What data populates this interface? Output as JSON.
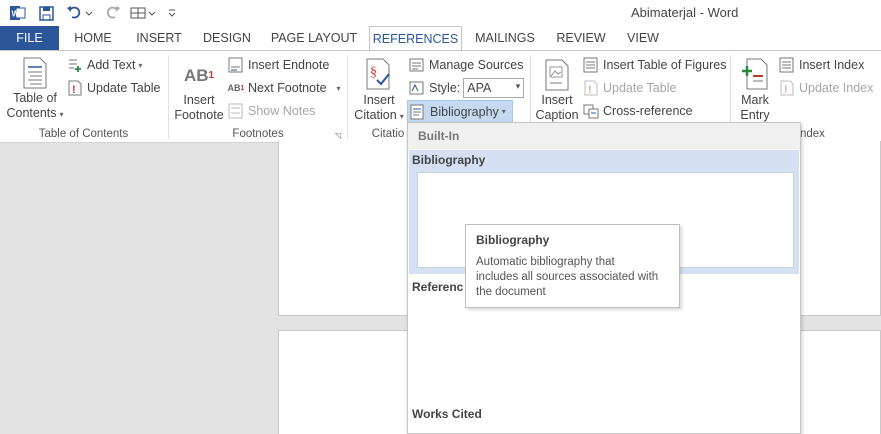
{
  "window": {
    "title": "Abimaterjal - Word"
  },
  "qat": {
    "undo_icon": "undo-icon",
    "redo_icon": "redo-icon"
  },
  "tabs": [
    {
      "label": "FILE"
    },
    {
      "label": "HOME"
    },
    {
      "label": "INSERT"
    },
    {
      "label": "DESIGN"
    },
    {
      "label": "PAGE LAYOUT"
    },
    {
      "label": "REFERENCES"
    },
    {
      "label": "MAILINGS"
    },
    {
      "label": "REVIEW"
    },
    {
      "label": "VIEW"
    }
  ],
  "ribbon": {
    "toc": {
      "table_of_contents_line1": "Table of",
      "table_of_contents_line2": "Contents",
      "add_text": "Add Text",
      "update_table": "Update Table",
      "group_label": "Table of Contents"
    },
    "footnotes": {
      "insert_footnote_line1": "Insert",
      "insert_footnote_line2": "Footnote",
      "ab_glyph": "AB",
      "sup_glyph": "1",
      "insert_endnote": "Insert Endnote",
      "next_footnote": "Next Footnote",
      "show_notes": "Show Notes",
      "group_label": "Footnotes"
    },
    "citations": {
      "insert_citation_line1": "Insert",
      "insert_citation_line2": "Citation",
      "manage_sources": "Manage Sources",
      "style_label": "Style:",
      "style_value": "APA",
      "bibliography": "Bibliography",
      "group_label": "Citatio"
    },
    "captions": {
      "insert_caption_line1": "Insert",
      "insert_caption_line2": "Caption",
      "insert_table_of_figures": "Insert Table of Figures",
      "update_table": "Update Table",
      "cross_reference": "Cross-reference"
    },
    "index": {
      "mark_entry_line1": "Mark",
      "mark_entry_line2": "Entry",
      "insert_index": "Insert Index",
      "update_index": "Update Index",
      "group_label": "ndex"
    }
  },
  "gallery": {
    "header": "Built-In",
    "items": [
      {
        "title": "Bibliography"
      },
      {
        "title": "Referenc"
      },
      {
        "title": "Works Cited"
      }
    ]
  },
  "tooltip": {
    "title": "Bibliography",
    "body_line1": "Automatic bibliography that",
    "body_line2": "includes all sources associated with",
    "body_line3": "the document"
  },
  "colors": {
    "accent": "#2b579a",
    "selected": "#d5e1f2"
  }
}
